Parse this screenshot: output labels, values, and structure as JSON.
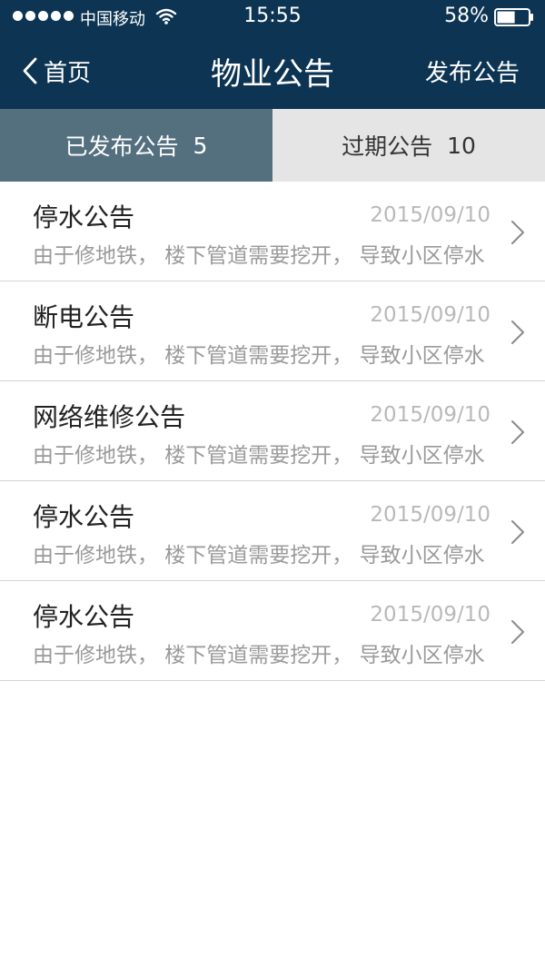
{
  "status_bar": {
    "carrier": "中国移动",
    "time": "15:55",
    "battery": "58%",
    "battery_level": 0.58,
    "signal_icon": "signal-dots-icon",
    "wifi_icon": "wifi-icon",
    "battery_icon": "battery-icon"
  },
  "nav": {
    "back_label": "首页",
    "title": "物业公告",
    "publish_label": "发布公告",
    "back_icon": "chevron-left-icon"
  },
  "tabs": [
    {
      "label": "已发布公告",
      "count": "5",
      "active": true
    },
    {
      "label": "过期公告",
      "count": "10",
      "active": false
    }
  ],
  "notices": [
    {
      "title": "停水公告",
      "date": "2015/09/10",
      "excerpt": "由于修地铁， 楼下管道需要挖开， 导致小区停水"
    },
    {
      "title": "断电公告",
      "date": "2015/09/10",
      "excerpt": "由于修地铁， 楼下管道需要挖开， 导致小区停水"
    },
    {
      "title": "网络维修公告",
      "date": "2015/09/10",
      "excerpt": "由于修地铁， 楼下管道需要挖开， 导致小区停水"
    },
    {
      "title": "停水公告",
      "date": "2015/09/10",
      "excerpt": "由于修地铁， 楼下管道需要挖开， 导致小区停水"
    },
    {
      "title": "停水公告",
      "date": "2015/09/10",
      "excerpt": "由于修地铁， 楼下管道需要挖开， 导致小区停水"
    }
  ],
  "colors": {
    "header_bg": "#0d3553",
    "tab_active_bg": "#54707f",
    "tab_inactive_bg": "#e5e5e5",
    "date_text": "#b9b9b9",
    "excerpt_text": "#9a9a9a"
  }
}
